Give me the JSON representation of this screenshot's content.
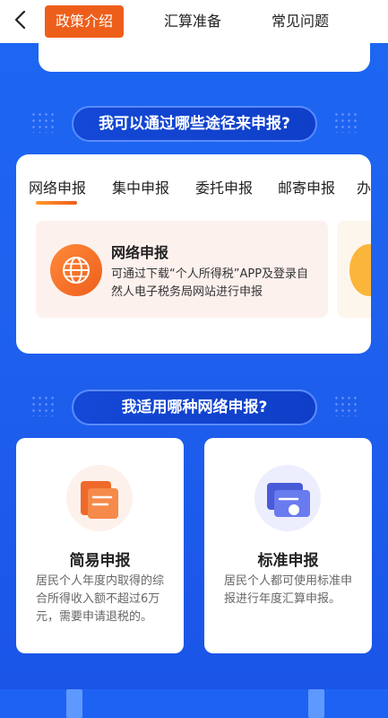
{
  "nav": {
    "tabs": [
      {
        "label": "政策介绍",
        "active": true
      },
      {
        "label": "汇算准备",
        "active": false
      },
      {
        "label": "常见问题",
        "active": false
      }
    ]
  },
  "section1": {
    "title": "我可以通过哪些途径来申报?",
    "tabs": [
      "网络申报",
      "集中申报",
      "委托申报",
      "邮寄申报",
      "办"
    ],
    "method": {
      "title": "网络申报",
      "desc": "可通过下载“个人所得税”APP及登录自然人电子税务局网站进行申报"
    }
  },
  "section2": {
    "title": "我适用哪种网络申报?",
    "cards": [
      {
        "title": "简易申报",
        "desc": "居民个人年度内取得的综合所得收入额不超过6万元，需要申请退税的。"
      },
      {
        "title": "标准申报",
        "desc": "居民个人都可使用标准申报进行年度汇算申报。"
      }
    ]
  },
  "colors": {
    "accent": "#ee5e1b",
    "primary": "#1a5cf0"
  }
}
